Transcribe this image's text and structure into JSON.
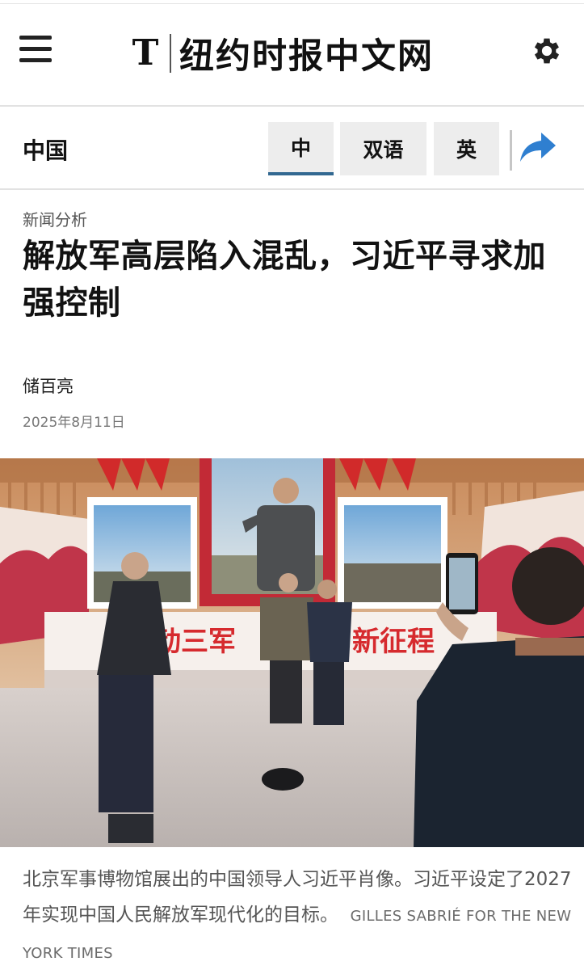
{
  "header": {
    "logo_mark": "T",
    "logo_text": "纽约时报中文网",
    "menu_icon": "hamburger-menu-icon",
    "settings_icon": "gear-icon"
  },
  "section_bar": {
    "section_name": "中国",
    "tabs": [
      {
        "label": "中",
        "selected": true
      },
      {
        "label": "双语",
        "selected": false
      },
      {
        "label": "英",
        "selected": false
      }
    ],
    "share_icon": "share-arrow-icon"
  },
  "article": {
    "kicker": "新闻分析",
    "headline": "解放军高层陷入混乱，习近平寻求加强控制",
    "byline": "储百亮",
    "date": "2025年8月11日",
    "banner_text_left": "动三军",
    "banner_text_right": "新征程",
    "caption": "北京军事博物馆展出的中国领导人习近平肖像。习近平设定了2027年实现中国人民解放军现代化的目标。",
    "credit": "GILLES SABRIÉ FOR THE NEW YORK TIMES"
  },
  "colors": {
    "accent_blue": "#326891",
    "tab_bg": "#ededed",
    "share_blue": "#2f7fd0"
  }
}
